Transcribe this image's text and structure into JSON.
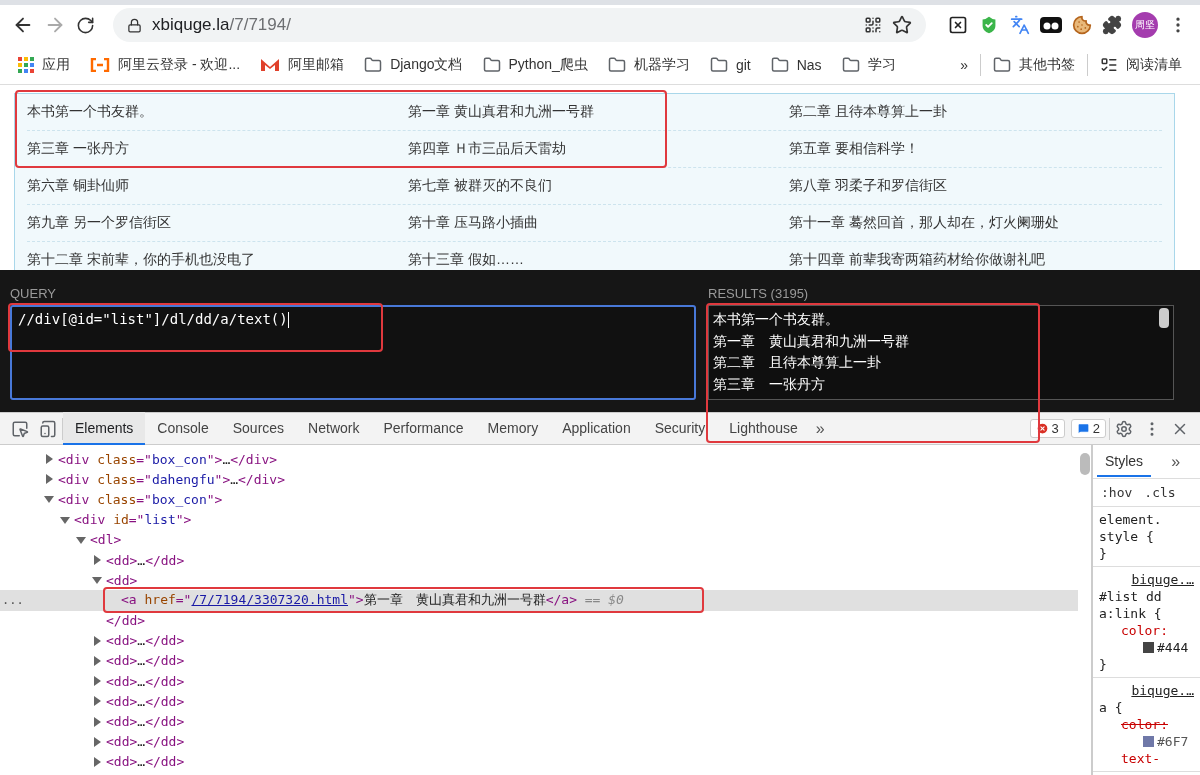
{
  "browser": {
    "url_host": "xbiquge.la",
    "url_path": "/7/7194/",
    "profile": "周坚"
  },
  "bookmarks": [
    {
      "label": "应用",
      "kind": "apps"
    },
    {
      "label": "阿里云登录 - 欢迎...",
      "kind": "aliyun"
    },
    {
      "label": "阿里邮箱",
      "kind": "mail"
    },
    {
      "label": "Django文档",
      "kind": "folder"
    },
    {
      "label": "Python_爬虫",
      "kind": "folder"
    },
    {
      "label": "机器学习",
      "kind": "folder"
    },
    {
      "label": "git",
      "kind": "folder"
    },
    {
      "label": "Nas",
      "kind": "folder"
    },
    {
      "label": "学习",
      "kind": "folder"
    }
  ],
  "bookmarks_overflow": "»",
  "bookmarks_right": [
    {
      "label": "其他书签",
      "kind": "folder"
    },
    {
      "label": "阅读清单",
      "kind": "reading"
    }
  ],
  "chapters": [
    [
      "本书第一个书友群。",
      "第一章 黄山真君和九洲一号群",
      "第二章 且待本尊算上一卦"
    ],
    [
      "第三章 一张丹方",
      "第四章 Ｈ市三品后天雷劫",
      "第五章 要相信科学！"
    ],
    [
      "第六章 铜卦仙师",
      "第七章 被群灭的不良们",
      "第八章 羽柔子和罗信街区"
    ],
    [
      "第九章 另一个罗信街区",
      "第十章 压马路小插曲",
      "第十一章 蓦然回首，那人却在，灯火阑珊处"
    ],
    [
      "第十二章 宋前辈，你的手机也没电了",
      "第十三章 假如……",
      "第十四章 前辈我寄两箱药材给你做谢礼吧"
    ]
  ],
  "xpath": {
    "query_label": "QUERY",
    "query": "//div[@id=\"list\"]/dl/dd/a/text()",
    "results_label": "RESULTS (3195)",
    "results": [
      "本书第一个书友群。",
      "第一章　黄山真君和九洲一号群",
      "第二章　且待本尊算上一卦",
      "第三章　一张丹方"
    ]
  },
  "devtools": {
    "tabs": [
      {
        "label": "Elements",
        "selected": true
      },
      {
        "label": "Console",
        "selected": false
      },
      {
        "label": "Sources",
        "selected": false
      },
      {
        "label": "Network",
        "selected": false
      },
      {
        "label": "Performance",
        "selected": false
      },
      {
        "label": "Memory",
        "selected": false
      },
      {
        "label": "Application",
        "selected": false
      },
      {
        "label": "Security",
        "selected": false
      },
      {
        "label": "Lighthouse",
        "selected": false
      }
    ],
    "tabs_overflow": "»",
    "errors": "3",
    "messages": "2",
    "dom": [
      {
        "parts": [
          {
            "kind": "tag",
            "text": "<div"
          },
          {
            "kind": "attr",
            "text": " class"
          },
          {
            "kind": "tag",
            "text": "=\""
          },
          {
            "kind": "value",
            "text": "box_con"
          },
          {
            "kind": "tag",
            "text": "\">"
          },
          {
            "kind": "text",
            "text": "…"
          },
          {
            "kind": "tag",
            "text": "</div>"
          }
        ],
        "expanded": false,
        "selected": false
      },
      {
        "parts": [
          {
            "kind": "tag",
            "text": "<div"
          },
          {
            "kind": "attr",
            "text": " class"
          },
          {
            "kind": "tag",
            "text": "=\""
          },
          {
            "kind": "value",
            "text": "dahengfu"
          },
          {
            "kind": "tag",
            "text": "\">"
          },
          {
            "kind": "text",
            "text": "…"
          },
          {
            "kind": "tag",
            "text": "</div>"
          }
        ],
        "expanded": false,
        "selected": false
      },
      {
        "parts": [
          {
            "kind": "tag",
            "text": "<div"
          },
          {
            "kind": "attr",
            "text": " class"
          },
          {
            "kind": "tag",
            "text": "=\""
          },
          {
            "kind": "value",
            "text": "box_con"
          },
          {
            "kind": "tag",
            "text": "\">"
          }
        ],
        "expanded": true,
        "selected": false,
        "children": [
          {
            "parts": [
              {
                "kind": "tag",
                "text": "<div"
              },
              {
                "kind": "attr",
                "text": " id"
              },
              {
                "kind": "tag",
                "text": "=\""
              },
              {
                "kind": "value",
                "text": "list"
              },
              {
                "kind": "tag",
                "text": "\">"
              }
            ],
            "expanded": true,
            "selected": false,
            "children": [
              {
                "parts": [
                  {
                    "kind": "tag",
                    "text": "<dl>"
                  }
                ],
                "expanded": true,
                "selected": false,
                "children": [
                  {
                    "parts": [
                      {
                        "kind": "tag",
                        "text": "<dd>"
                      },
                      {
                        "kind": "text",
                        "text": "…"
                      },
                      {
                        "kind": "tag",
                        "text": "</dd>"
                      }
                    ],
                    "expanded": false,
                    "selected": false
                  },
                  {
                    "parts": [
                      {
                        "kind": "tag",
                        "text": "<dd>"
                      }
                    ],
                    "expanded": true,
                    "selected": false,
                    "closing": [
                      {
                        "kind": "tag",
                        "text": "</dd>"
                      }
                    ],
                    "children": [
                      {
                        "parts": [
                          {
                            "kind": "tag",
                            "text": "<a"
                          },
                          {
                            "kind": "attr",
                            "text": " href"
                          },
                          {
                            "kind": "tag",
                            "text": "=\""
                          },
                          {
                            "kind": "link",
                            "text": "/7/7194/3307320.html"
                          },
                          {
                            "kind": "tag",
                            "text": "\">"
                          },
                          {
                            "kind": "text",
                            "text": "第一章　黄山真君和九洲一号群"
                          },
                          {
                            "kind": "tag",
                            "text": "</a>"
                          },
                          {
                            "kind": "hint",
                            "text": " == $0"
                          }
                        ],
                        "selected": true,
                        "annotated": true,
                        "gutter": "..."
                      }
                    ]
                  },
                  {
                    "parts": [
                      {
                        "kind": "tag",
                        "text": "<dd>"
                      },
                      {
                        "kind": "text",
                        "text": "…"
                      },
                      {
                        "kind": "tag",
                        "text": "</dd>"
                      }
                    ],
                    "expanded": false,
                    "selected": false
                  },
                  {
                    "parts": [
                      {
                        "kind": "tag",
                        "text": "<dd>"
                      },
                      {
                        "kind": "text",
                        "text": "…"
                      },
                      {
                        "kind": "tag",
                        "text": "</dd>"
                      }
                    ],
                    "expanded": false,
                    "selected": false
                  },
                  {
                    "parts": [
                      {
                        "kind": "tag",
                        "text": "<dd>"
                      },
                      {
                        "kind": "text",
                        "text": "…"
                      },
                      {
                        "kind": "tag",
                        "text": "</dd>"
                      }
                    ],
                    "expanded": false,
                    "selected": false
                  },
                  {
                    "parts": [
                      {
                        "kind": "tag",
                        "text": "<dd>"
                      },
                      {
                        "kind": "text",
                        "text": "…"
                      },
                      {
                        "kind": "tag",
                        "text": "</dd>"
                      }
                    ],
                    "expanded": false,
                    "selected": false
                  },
                  {
                    "parts": [
                      {
                        "kind": "tag",
                        "text": "<dd>"
                      },
                      {
                        "kind": "text",
                        "text": "…"
                      },
                      {
                        "kind": "tag",
                        "text": "</dd>"
                      }
                    ],
                    "expanded": false,
                    "selected": false
                  },
                  {
                    "parts": [
                      {
                        "kind": "tag",
                        "text": "<dd>"
                      },
                      {
                        "kind": "text",
                        "text": "…"
                      },
                      {
                        "kind": "tag",
                        "text": "</dd>"
                      }
                    ],
                    "expanded": false,
                    "selected": false
                  },
                  {
                    "parts": [
                      {
                        "kind": "tag",
                        "text": "<dd>"
                      },
                      {
                        "kind": "text",
                        "text": "…"
                      },
                      {
                        "kind": "tag",
                        "text": "</dd>"
                      }
                    ],
                    "expanded": false,
                    "selected": false
                  }
                ]
              }
            ]
          }
        ]
      }
    ],
    "styles": {
      "tabs": [
        {
          "label": "Styles",
          "selected": true
        }
      ],
      "tabs_overflow": "»",
      "filters": [
        ":hov",
        ".cls"
      ],
      "rules": [
        {
          "lines": [
            "element.",
            "style {"
          ],
          "close": "}"
        },
        {
          "source": "biquge.…",
          "lines": [
            "#list dd",
            "a:link {"
          ],
          "decls": [
            {
              "prop": "color:",
              "value": "#444",
              "color": "#444444",
              "struck": false
            }
          ],
          "close": "}"
        },
        {
          "source": "biquge.…",
          "lines": [
            "a {"
          ],
          "decls": [
            {
              "prop": "color:",
              "value": "#6F7",
              "color": "#6f78a8",
              "struck": true
            },
            {
              "prop": "text-",
              "struck": false
            }
          ]
        }
      ]
    }
  }
}
